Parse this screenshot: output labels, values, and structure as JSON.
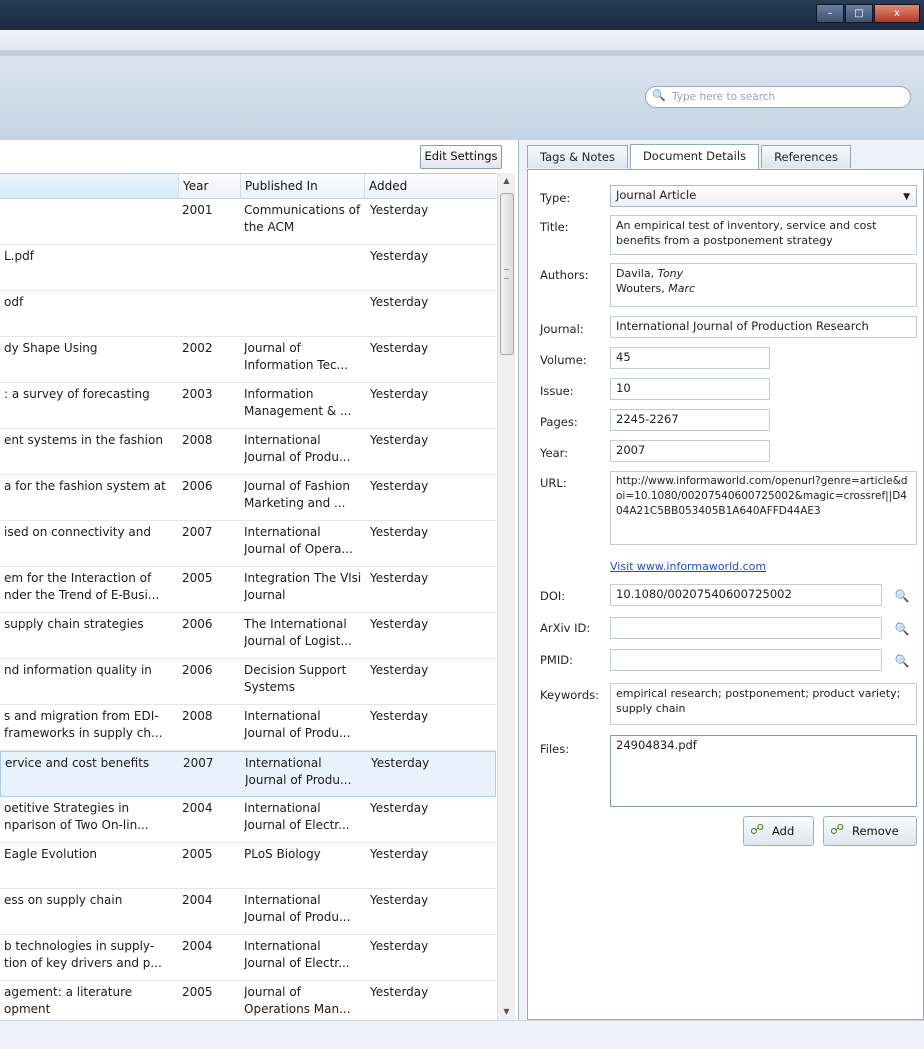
{
  "window": {
    "min": "–",
    "max": "□",
    "close": "x"
  },
  "search": {
    "placeholder": "Type here to search"
  },
  "list": {
    "edit_settings": "Edit Settings",
    "columns": {
      "title": "",
      "year": "Year",
      "published_in": "Published In",
      "added": "Added"
    },
    "rows": [
      {
        "title": "",
        "year": "2001",
        "pub": "Communications of the ACM",
        "added": "Yesterday"
      },
      {
        "title": "L.pdf",
        "year": "",
        "pub": "",
        "added": "Yesterday"
      },
      {
        "title": "odf",
        "year": "",
        "pub": "",
        "added": "Yesterday"
      },
      {
        "title": "dy Shape Using",
        "year": "2002",
        "pub": "Journal of Information Tec...",
        "added": "Yesterday"
      },
      {
        "title": ": a survey of forecasting",
        "year": "2003",
        "pub": "Information Management & ...",
        "added": "Yesterday"
      },
      {
        "title": "ent systems in the fashion",
        "year": "2008",
        "pub": "International Journal of Produ...",
        "added": "Yesterday"
      },
      {
        "title": "a for the fashion system at",
        "year": "2006",
        "pub": "Journal of Fashion Marketing and ...",
        "added": "Yesterday"
      },
      {
        "title": "ised on connectivity and",
        "year": "2007",
        "pub": "International Journal of Opera...",
        "added": "Yesterday"
      },
      {
        "title": "em for the Interaction of nder the Trend of E-Busi...",
        "year": "2005",
        "pub": "Integration The Vlsi Journal",
        "added": "Yesterday"
      },
      {
        "title": "supply chain strategies",
        "year": "2006",
        "pub": "The International Journal of Logist...",
        "added": "Yesterday"
      },
      {
        "title": "nd information quality in",
        "year": "2006",
        "pub": "Decision Support Systems",
        "added": "Yesterday"
      },
      {
        "title": "s and migration from EDI- frameworks in supply ch...",
        "year": "2008",
        "pub": "International Journal of Produ...",
        "added": "Yesterday"
      },
      {
        "title": "ervice and cost benefits",
        "year": "2007",
        "pub": "International Journal of Produ...",
        "added": "Yesterday",
        "selected": true
      },
      {
        "title": "oetitive Strategies in nparison of Two On-lin...",
        "year": "2004",
        "pub": "International Journal of Electr...",
        "added": "Yesterday"
      },
      {
        "title": "Eagle Evolution",
        "year": "2005",
        "pub": "PLoS Biology",
        "added": "Yesterday"
      },
      {
        "title": "ess on supply chain",
        "year": "2004",
        "pub": "International Journal of Produ...",
        "added": "Yesterday"
      },
      {
        "title": "b technologies in supply- tion of key drivers and p...",
        "year": "2004",
        "pub": "International Journal of Electr...",
        "added": "Yesterday"
      },
      {
        "title": "agement: a literature opment",
        "year": "2005",
        "pub": "Journal of Operations Man...",
        "added": "Yesterday"
      }
    ]
  },
  "details": {
    "tabs": [
      "Tags & Notes",
      "Document Details",
      "References"
    ],
    "active_tab": "Document Details",
    "type_label": "Type:",
    "type_value": "Journal Article",
    "title_label": "Title:",
    "title_value": "An empirical test of inventory, service and cost benefits from a postponement strategy",
    "authors_label": "Authors:",
    "author1_last": "Davila,",
    "author1_first": "Tony",
    "author2_last": "Wouters,",
    "author2_first": "Marc",
    "journal_label": "Journal:",
    "journal_value": "International Journal of Production Research",
    "volume_label": "Volume:",
    "volume_value": "45",
    "issue_label": "Issue:",
    "issue_value": "10",
    "pages_label": "Pages:",
    "pages_value": "2245-2267",
    "year_label": "Year:",
    "year_value": "2007",
    "url_label": "URL:",
    "url_value": "http://www.informaworld.com/openurl?genre=article&doi=10.1080/00207540600725002&magic=crossref||D404A21C5BB053405B1A640AFFD44AE3",
    "visit_link": "Visit www.informaworld.com",
    "doi_label": "DOI:",
    "doi_value": "10.1080/00207540600725002",
    "arxiv_label": "ArXiv ID:",
    "arxiv_value": "",
    "pmid_label": "PMID:",
    "pmid_value": "",
    "keywords_label": "Keywords:",
    "keywords_value": "empirical research; postponement; product variety; supply chain",
    "files_label": "Files:",
    "files_value": "24904834.pdf",
    "add_button": "Add",
    "remove_button": "Remove"
  }
}
